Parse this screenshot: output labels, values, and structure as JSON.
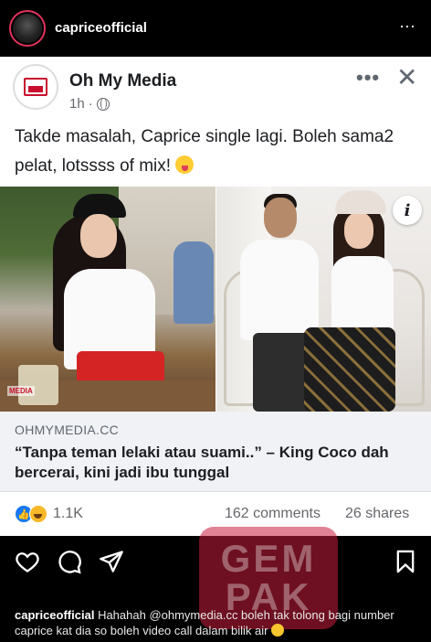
{
  "instagram": {
    "username": "capriceofficial",
    "more_icon": "⋯",
    "actions": [
      "heart-icon",
      "comment-icon",
      "share-icon",
      "bookmark-icon"
    ],
    "caption_user": "capriceofficial",
    "caption_text": "Hahahah @ohmymedia.cc boleh tak tolong bagi number caprice kat dia so boleh video call dalam bilik air"
  },
  "facebook_post": {
    "page_name": "Oh My Media",
    "time": "1h",
    "separator": "·",
    "more_icon": "•••",
    "close_icon": "✕",
    "text": "Takde masalah, Caprice single lagi. Boleh sama2 pelat, lotssss of mix!",
    "info_icon": "i",
    "link_domain": "OHMYMEDIA.CC",
    "link_title": "“Tanpa teman lelaki atau suami..” – King Coco dah bercerai, kini jadi ibu tunggal",
    "reaction_count": "1.1K",
    "comments": "162 comments",
    "shares": "26 shares"
  },
  "watermark": {
    "line1": "GEM",
    "line2": "PAK"
  },
  "colors": {
    "fb_blue": "#1877f2",
    "brand_red": "#c8102e",
    "ig_background": "#000000"
  }
}
